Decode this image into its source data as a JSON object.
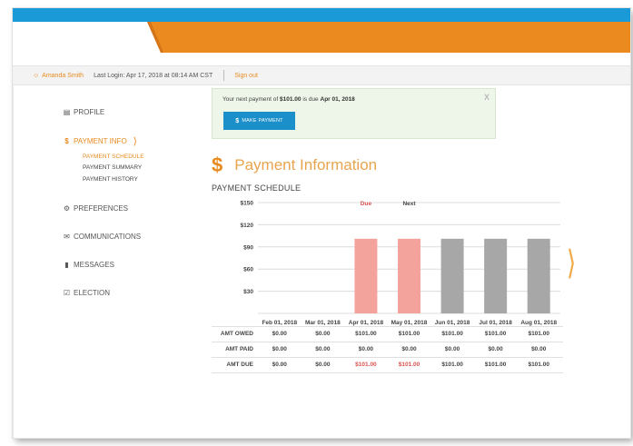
{
  "header": {
    "user_name": "Amanda Smith",
    "last_login": "Last Login: Apr 17, 2018 at 08:14 AM CST",
    "sign_out": "Sign out",
    "colors": {
      "top_bar": "#1a9bd7",
      "accent": "#e88a1e"
    }
  },
  "sidebar": {
    "items": [
      {
        "label": "PROFILE",
        "icon": "id-card-icon"
      },
      {
        "label": "PAYMENT INFO",
        "icon": "dollar-icon"
      },
      {
        "label": "PREFERENCES",
        "icon": "settings-icon"
      },
      {
        "label": "COMMUNICATIONS",
        "icon": "envelope-icon"
      },
      {
        "label": "MESSAGES",
        "icon": "chat-bubble-icon"
      },
      {
        "label": "ELECTION",
        "icon": "checkbox-icon"
      }
    ],
    "subitems": [
      "PAYMENT SCHEDULE",
      "PAYMENT SUMMARY",
      "PAYMENT HISTORY"
    ]
  },
  "alert": {
    "msg_pre": "Your next payment of",
    "amount": "$101.00",
    "msg_mid": "is due",
    "date": "Apr 01, 2018",
    "close": "X",
    "button_symbol": "$",
    "button_label": "MAKE PAYMENT"
  },
  "main": {
    "title_symbol": "$",
    "title": "Payment Information",
    "schedule_heading": "PAYMENT SCHEDULE"
  },
  "chart_data": {
    "type": "bar",
    "categories": [
      "Feb 01, 2018",
      "Mar 01, 2018",
      "Apr 01, 2018",
      "May 01, 2018",
      "Jun 01, 2018",
      "Jul 01, 2018",
      "Aug 01, 2018"
    ],
    "values": [
      0,
      0,
      101,
      101,
      101,
      101,
      101
    ],
    "ylim": [
      0,
      150
    ],
    "y_ticks": [
      30,
      60,
      90,
      120,
      150
    ],
    "y_tick_labels": [
      "$30",
      "$60",
      "$90",
      "$120",
      "$150"
    ],
    "grid": true,
    "annotations": [
      {
        "label": "Due",
        "category_index": 2,
        "color": "#d9534f"
      },
      {
        "label": "Next",
        "category_index": 3,
        "color": "#444444"
      }
    ],
    "bar_colors": [
      "#f4a39c",
      "#f4a39c",
      "#f4a39c",
      "#f4a39c",
      "#a7a7a7",
      "#a7a7a7",
      "#a7a7a7"
    ]
  },
  "table": {
    "rows": [
      {
        "label": "AMT OWED",
        "values": [
          "$0.00",
          "$0.00",
          "$101.00",
          "$101.00",
          "$101.00",
          "$101.00",
          "$101.00"
        ]
      },
      {
        "label": "AMT PAID",
        "values": [
          "$0.00",
          "$0.00",
          "$0.00",
          "$0.00",
          "$0.00",
          "$0.00",
          "$0.00"
        ]
      },
      {
        "label": "AMT DUE",
        "values": [
          "$0.00",
          "$0.00",
          "$101.00",
          "$101.00",
          "$101.00",
          "$101.00",
          "$101.00"
        ],
        "due_highlight": [
          2,
          3
        ]
      }
    ]
  }
}
